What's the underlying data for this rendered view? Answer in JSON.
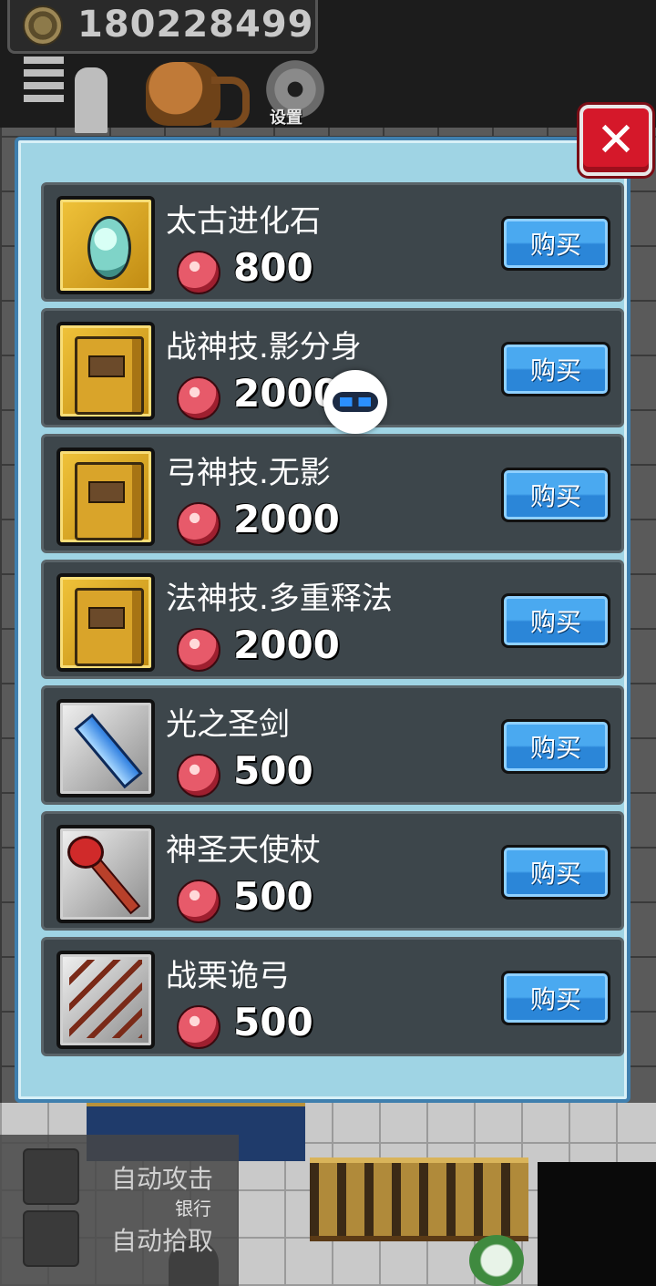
{
  "hud": {
    "coin_count": "180228499",
    "settings_label": "设置"
  },
  "shop": {
    "close_label": "✕",
    "items": [
      {
        "name": "太古进化石",
        "price": "800",
        "buy_label": "购买",
        "icon": "evolution-stone-icon"
      },
      {
        "name": "战神技.影分身",
        "price": "2000",
        "buy_label": "购买",
        "icon": "skill-book-icon"
      },
      {
        "name": "弓神技.无影",
        "price": "2000",
        "buy_label": "购买",
        "icon": "skill-book-icon"
      },
      {
        "name": "法神技.多重释法",
        "price": "2000",
        "buy_label": "购买",
        "icon": "skill-book-icon"
      },
      {
        "name": "光之圣剑",
        "price": "500",
        "buy_label": "购买",
        "icon": "holy-sword-icon"
      },
      {
        "name": "神圣天使杖",
        "price": "500",
        "buy_label": "购买",
        "icon": "angel-staff-icon"
      },
      {
        "name": "战栗诡弓",
        "price": "500",
        "buy_label": "购买",
        "icon": "bow-icon"
      }
    ]
  },
  "controls": {
    "auto_attack": "自动攻击",
    "auto_pickup": "自动拾取",
    "bank": "银行"
  },
  "colors": {
    "panel": "#9fd4e4",
    "panel_border": "#3f7fae",
    "row": "#3d464b",
    "buy_button": "#2b86d8",
    "close_button": "#d5182a"
  }
}
